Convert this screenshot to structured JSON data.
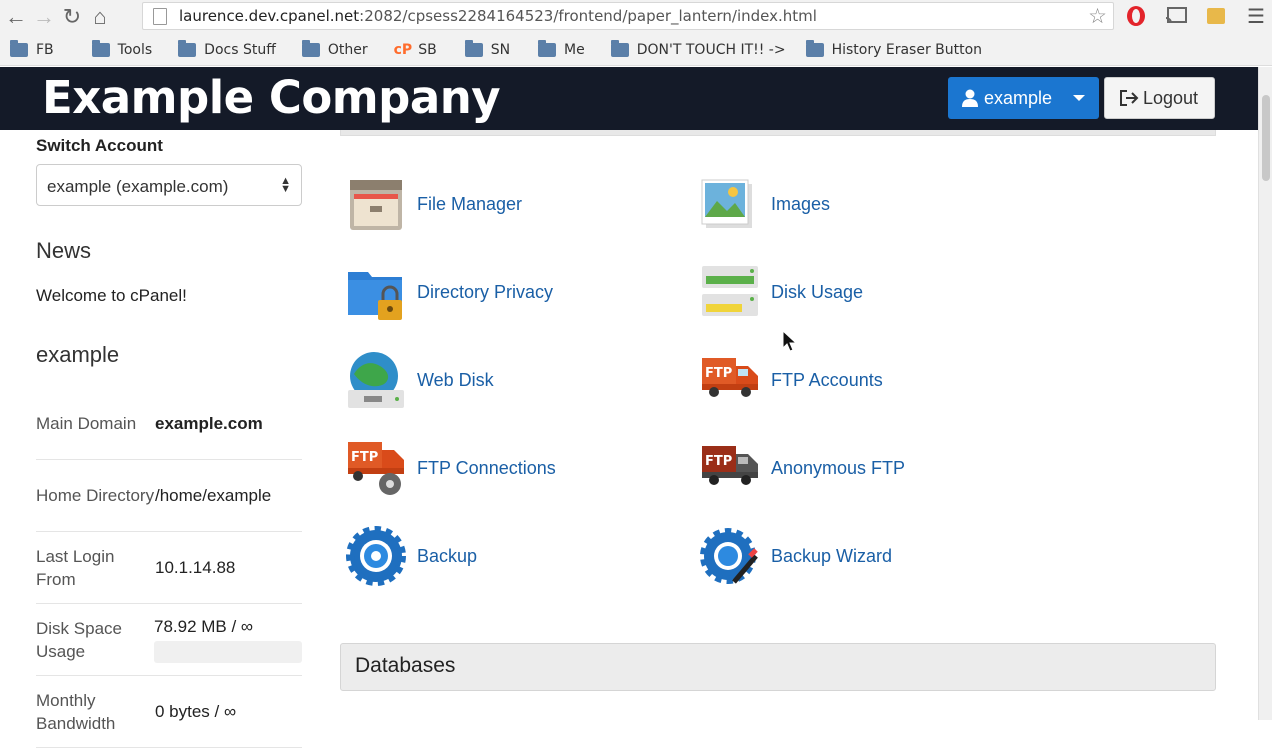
{
  "browser": {
    "url_host": "laurence.dev.cpanel.net",
    "url_rest": ":2082/cpsess2284164523/frontend/paper_lantern/index.html",
    "bookmarks": [
      {
        "label": "FB",
        "icon": "folder-icon"
      },
      {
        "label": "Tools",
        "icon": "folder-icon"
      },
      {
        "label": "Docs Stuff",
        "icon": "folder-icon"
      },
      {
        "label": "Other",
        "icon": "folder-icon"
      },
      {
        "label": "SB",
        "icon": "cpanel-icon"
      },
      {
        "label": "SN",
        "icon": "folder-icon"
      },
      {
        "label": "Me",
        "icon": "folder-icon"
      },
      {
        "label": "DON'T TOUCH IT!! ->",
        "icon": "folder-icon"
      },
      {
        "label": "History Eraser Button",
        "icon": "folder-icon"
      }
    ]
  },
  "header": {
    "brand": "Example Company",
    "user_label": "example",
    "logout_label": "Logout"
  },
  "sidebar": {
    "switch_account_label": "Switch Account",
    "account_select_value": "example (example.com)",
    "news_heading": "News",
    "news_text": "Welcome to cPanel!",
    "account_heading": "example",
    "stats": [
      {
        "key": "Main Domain",
        "value": "example.com"
      },
      {
        "key": "Home Directory",
        "value": "/home/example"
      },
      {
        "key": "Last Login From",
        "value": "10.1.14.88"
      },
      {
        "key": "Disk Space Usage",
        "value": "78.92 MB / ∞"
      },
      {
        "key": "Monthly Bandwidth",
        "value": "0 bytes / ∞"
      }
    ]
  },
  "files": {
    "items": [
      {
        "label": "File Manager",
        "icon": "file-manager-icon"
      },
      {
        "label": "Images",
        "icon": "images-icon"
      },
      {
        "label": "Directory Privacy",
        "icon": "directory-privacy-icon"
      },
      {
        "label": "Disk Usage",
        "icon": "disk-usage-icon"
      },
      {
        "label": "Web Disk",
        "icon": "web-disk-icon"
      },
      {
        "label": "FTP Accounts",
        "icon": "ftp-accounts-icon"
      },
      {
        "label": "FTP Connections",
        "icon": "ftp-connections-icon"
      },
      {
        "label": "Anonymous FTP",
        "icon": "anonymous-ftp-icon"
      },
      {
        "label": "Backup",
        "icon": "backup-icon"
      },
      {
        "label": "Backup Wizard",
        "icon": "backup-wizard-icon"
      }
    ],
    "ftp_badge": "FTP"
  },
  "databases": {
    "heading": "Databases"
  },
  "colors": {
    "header_bg": "#141a28",
    "accent": "#1b76d0",
    "link": "#1a5fa6"
  }
}
